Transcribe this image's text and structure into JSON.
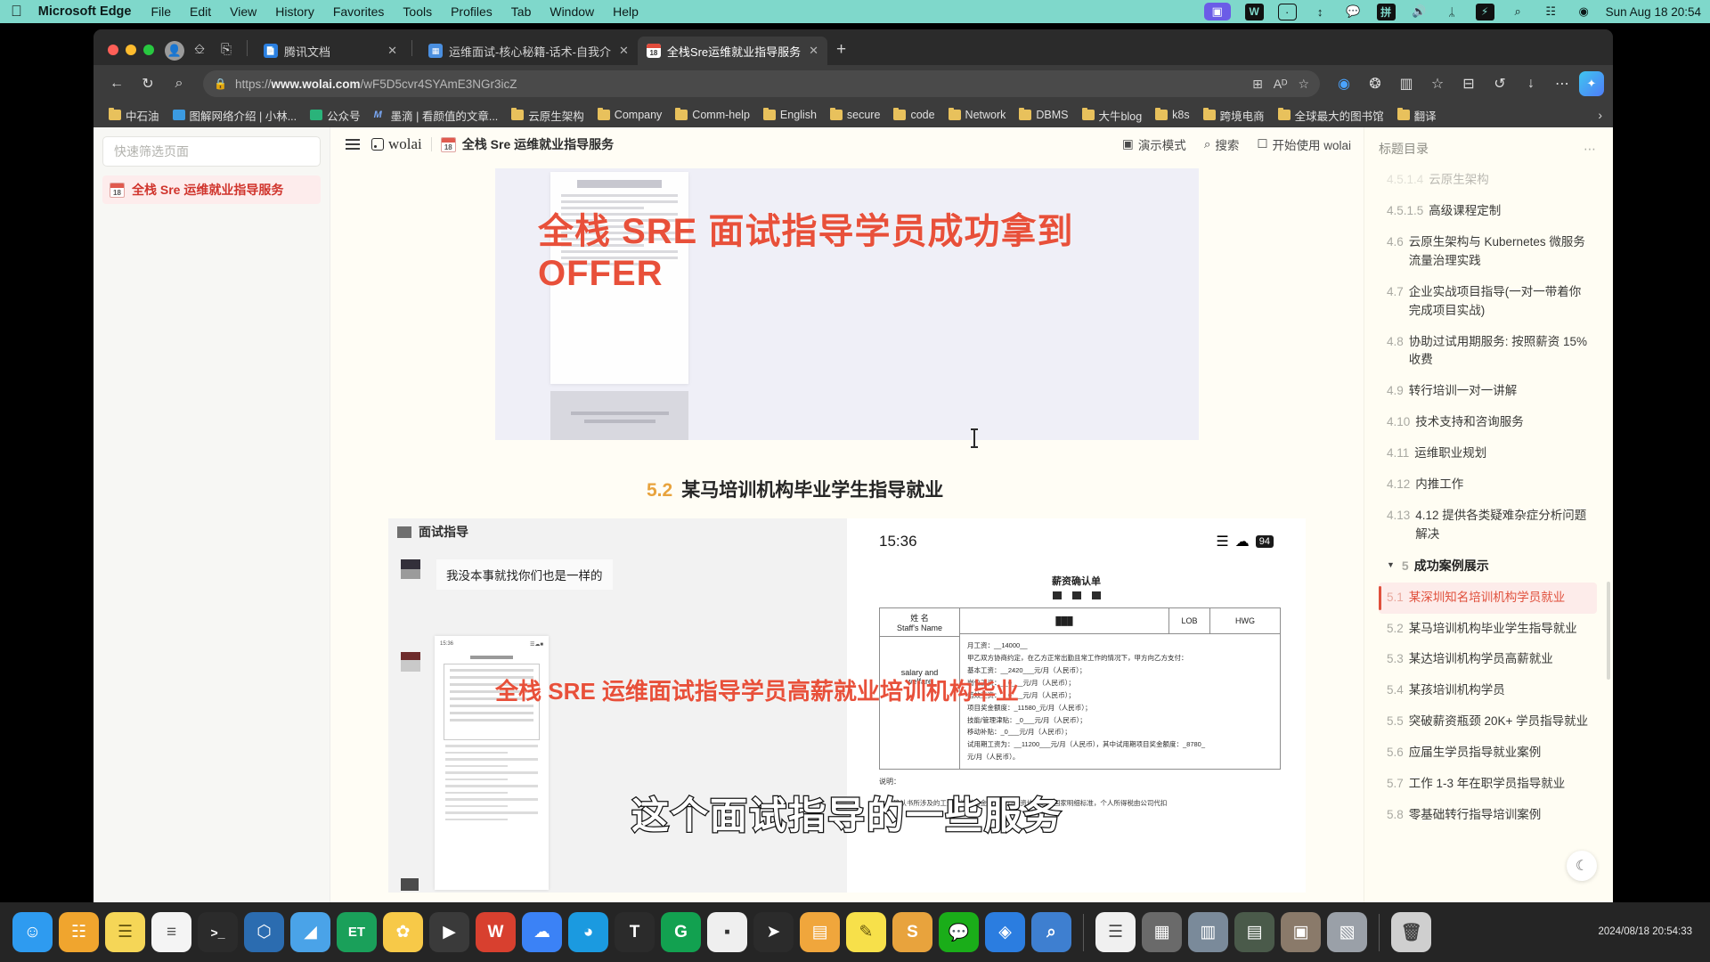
{
  "menubar": {
    "apple_icon": "apple-icon",
    "app": "Microsoft Edge",
    "items": [
      "File",
      "Edit",
      "View",
      "History",
      "Favorites",
      "Tools",
      "Profiles",
      "Tab",
      "Window",
      "Help"
    ],
    "tray": [
      {
        "name": "screen-share-icon",
        "glyph": "▣"
      },
      {
        "name": "wps-icon",
        "glyph": "W"
      },
      {
        "name": "wolai-icon",
        "glyph": "⊡"
      },
      {
        "name": "sort-icon",
        "glyph": "↕"
      },
      {
        "name": "wechat-icon",
        "glyph": "◕"
      },
      {
        "name": "input-method-icon",
        "glyph": "拼"
      },
      {
        "name": "volume-icon",
        "glyph": "◂))"
      },
      {
        "name": "bluetooth-icon",
        "glyph": "ᛦ"
      },
      {
        "name": "battery-icon",
        "glyph": "⚡"
      },
      {
        "name": "search-icon",
        "glyph": "⌕"
      },
      {
        "name": "control-center-icon",
        "glyph": "☷"
      },
      {
        "name": "siri-icon",
        "glyph": "◉"
      }
    ],
    "clock": "Sun Aug 18  20:54"
  },
  "browser": {
    "tabs": [
      {
        "title": "腾讯文档",
        "favicon": "tencent-docs-favicon",
        "active": false
      },
      {
        "title": "运维面试-核心秘籍-话术-自我介",
        "favicon": "doc-favicon",
        "active": false
      },
      {
        "title": "全栈Sre运维就业指导服务",
        "favicon": "calendar-favicon",
        "active": true
      }
    ],
    "new_tab_label": "+",
    "close_label": "✕",
    "toolbar": {
      "back": "←",
      "reload": "↻",
      "search": "⌕",
      "lock": "ὑ2",
      "url_prefix": "https://",
      "url_domain": "www.wolai.com",
      "url_path": "/wF5D5cvr4SYAmE3NGr3icZ",
      "right_icons": [
        "⊞",
        "Aᴰ",
        "☆"
      ],
      "actions": [
        "◉",
        "❂",
        "▥",
        "☆",
        "⊟",
        "↺",
        "↓",
        "⋯"
      ],
      "copilot": "copilot-icon"
    },
    "bookmarks": [
      {
        "label": "中石油",
        "icon": "folder"
      },
      {
        "label": "图解网络介绍 | 小林...",
        "icon": "globe"
      },
      {
        "label": "公众号",
        "icon": "green"
      },
      {
        "label": "墨滴 | 看颜值的文章...",
        "icon": "mo"
      },
      {
        "label": "云原生架构",
        "icon": "folder"
      },
      {
        "label": "Company",
        "icon": "folder"
      },
      {
        "label": "Comm-help",
        "icon": "folder"
      },
      {
        "label": "English",
        "icon": "folder"
      },
      {
        "label": "secure",
        "icon": "folder"
      },
      {
        "label": "code",
        "icon": "folder"
      },
      {
        "label": "Network",
        "icon": "folder"
      },
      {
        "label": "DBMS",
        "icon": "folder"
      },
      {
        "label": "大牛blog",
        "icon": "folder"
      },
      {
        "label": "k8s",
        "icon": "folder"
      },
      {
        "label": "跨境电商",
        "icon": "folder"
      },
      {
        "label": "全球最大的图书馆",
        "icon": "folder"
      },
      {
        "label": "翻译",
        "icon": "folder"
      }
    ],
    "bookmarks_overflow": "›"
  },
  "wolai": {
    "sidebar": {
      "filter_placeholder": "快速筛选页面",
      "page": {
        "label": "全栈 Sre 运维就业指导服务",
        "day": "18"
      }
    },
    "header": {
      "logo": "wolai",
      "breadcrumb": "全栈 Sre 运维就业指导服务",
      "breadcrumb_day": "18",
      "present_label": "演示模式",
      "search_label": "搜索",
      "start_label": "开始使用 wolai"
    },
    "content": {
      "hero_overlay": "全栈 SRE 面试指导学员成功拿到OFFER",
      "section_num": "5.2",
      "section_title": "某马培训机构毕业学生指导就业",
      "chat_name": "面试指导",
      "chat_message": "我没本事就找你们也是一样的",
      "phone_time": "15:36",
      "phone_battery": "94",
      "form_title": "薪资确认单",
      "form_label_name_cn": "姓  名",
      "form_label_name_en": "Staff's Name",
      "form_col_lob": "LOB",
      "form_col_hwg": "HWG",
      "form_label_salary_en": "salary and",
      "form_label_welfare_en": "welfare",
      "form_lines": [
        "月工资：__14000__",
        "甲乙双方协商约定，在乙方正常出勤且常工作的情况下，甲方向乙方支付：",
        "基本工资：__2420___元/月（人民币）；",
        "岗位工资：__0___元/月（人民币）；",
        "结效工资：__0___元/月（人民币）；",
        "项目奖金额度：_11580_元/月（人民币）；",
        "技能/管理津贴：_0___元/月（人民币）；",
        "移动补贴：_0___元/月（人民币）；",
        "试用期工资为：__11200___元/月（人民币），其中试用期项目奖金额度：_8780_",
        "元/月（人民币）。"
      ],
      "form_note": "说明：",
      "form_note_text": "1. 本确认书所涉及的工资均为税前金额，当月工资均需达到国家明细标准，个人所得税由公司代扣",
      "overlay_red": "全栈 SRE 运维面试指导学员高薪就业培训机构毕业",
      "overlay_white": "这个面试指导的一些服务"
    },
    "toc": {
      "title": "标题目录",
      "more": "⋯",
      "items": [
        {
          "num": "4.5.1.4",
          "text": "云原生架构",
          "level": 3,
          "faded": true
        },
        {
          "num": "4.5.1.5",
          "text": "高级课程定制",
          "level": 3
        },
        {
          "num": "4.6",
          "text": "云原生架构与 Kubernetes 微服务流量治理实践",
          "level": 2
        },
        {
          "num": "4.7",
          "text": "企业实战项目指导(一对一带着你完成项目实战)",
          "level": 2
        },
        {
          "num": "4.8",
          "text": "协助过试用期服务: 按照薪资 15% 收费",
          "level": 2
        },
        {
          "num": "4.9",
          "text": "转行培训一对一讲解",
          "level": 2
        },
        {
          "num": "4.10",
          "text": "技术支持和咨询服务",
          "level": 2
        },
        {
          "num": "4.11",
          "text": "运维职业规划",
          "level": 2
        },
        {
          "num": "4.12",
          "text": "内推工作",
          "level": 2
        },
        {
          "num": "4.13",
          "text": "4.12 提供各类疑难杂症分析问题解决",
          "level": 2
        },
        {
          "num": "5",
          "text": "成功案例展示",
          "level": 1,
          "caret": "▼"
        },
        {
          "num": "5.1",
          "text": "某深圳知名培训机构学员就业",
          "level": 2,
          "active": true
        },
        {
          "num": "5.2",
          "text": "某马培训机构毕业学生指导就业",
          "level": 2
        },
        {
          "num": "5.3",
          "text": "某达培训机构学员高薪就业",
          "level": 2
        },
        {
          "num": "5.4",
          "text": "某孩培训机构学员",
          "level": 2
        },
        {
          "num": "5.5",
          "text": "突破薪资瓶颈 20K+ 学员指导就业",
          "level": 2
        },
        {
          "num": "5.6",
          "text": "应届生学员指导就业案例",
          "level": 2
        },
        {
          "num": "5.7",
          "text": "工作 1-3 年在职学员指导就业",
          "level": 2
        },
        {
          "num": "5.8",
          "text": "零基础转行指导培训案例",
          "level": 2
        }
      ],
      "dark_mode_icon": "moon-icon"
    }
  },
  "dock": {
    "icons": [
      {
        "name": "finder-icon",
        "glyph": "☺",
        "color": "#2e9bf0"
      },
      {
        "name": "launchpad-icon",
        "glyph": "☷",
        "color": "#f0a52e"
      },
      {
        "name": "notes-icon",
        "glyph": "☰",
        "color": "#f5d657"
      },
      {
        "name": "reminders-icon",
        "glyph": "≡",
        "color": "#f4f4f4"
      },
      {
        "name": "terminal-icon",
        "glyph": "〉_",
        "color": "#2b2b2b"
      },
      {
        "name": "vscode-icon",
        "glyph": "⬡",
        "color": "#2b6cb0"
      },
      {
        "name": "charts-icon",
        "glyph": "◢",
        "color": "#4aa3e8"
      },
      {
        "name": "et-icon",
        "glyph": "ET",
        "color": "#1aa05a"
      },
      {
        "name": "photos-icon",
        "glyph": "✿",
        "color": "#f7c948"
      },
      {
        "name": "video-icon",
        "glyph": "▶",
        "color": "#3a3a3a"
      },
      {
        "name": "wps-writer-icon",
        "glyph": "W",
        "color": "#d8402f"
      },
      {
        "name": "onedrive-icon",
        "glyph": "☁",
        "color": "#3b82f6"
      },
      {
        "name": "edge-icon",
        "glyph": "◔",
        "color": "#1b9ae0"
      },
      {
        "name": "text-icon",
        "glyph": "T",
        "color": "#2b2b2b"
      },
      {
        "name": "grammarly-icon",
        "glyph": "G",
        "color": "#12a150"
      },
      {
        "name": "console-icon",
        "glyph": "▪",
        "color": "#efefef"
      },
      {
        "name": "cursor-icon",
        "glyph": "➤",
        "color": "#2b2b2b"
      },
      {
        "name": "books-icon",
        "glyph": "▤",
        "color": "#f0a63c"
      },
      {
        "name": "markup-icon",
        "glyph": "✎",
        "color": "#f7e04a"
      },
      {
        "name": "sublime-icon",
        "glyph": "S",
        "color": "#e8a33d"
      },
      {
        "name": "wechat-dock-icon",
        "glyph": "◕",
        "color": "#1aad19"
      },
      {
        "name": "store-icon",
        "glyph": "◈",
        "color": "#2b7de0"
      },
      {
        "name": "preview-icon",
        "glyph": "⌕",
        "color": "#3e7fd0"
      }
    ],
    "right_icons": [
      {
        "name": "document-icon",
        "glyph": "☰",
        "color": "#f0f0f0"
      },
      {
        "name": "window-1-icon",
        "glyph": "▦",
        "color": "#6a6a6a"
      },
      {
        "name": "window-2-icon",
        "glyph": "▥",
        "color": "#7a8a9a"
      },
      {
        "name": "window-3-icon",
        "glyph": "▤",
        "color": "#4a5a4a"
      },
      {
        "name": "window-4-icon",
        "glyph": "▣",
        "color": "#8a7a6a"
      },
      {
        "name": "window-5-icon",
        "glyph": "▧",
        "color": "#9aa0a8"
      },
      {
        "name": "trash-icon",
        "glyph": "Ὕ1",
        "color": "#cfcfcf"
      }
    ],
    "clock_date": "2024/08/18 20:54:33"
  }
}
